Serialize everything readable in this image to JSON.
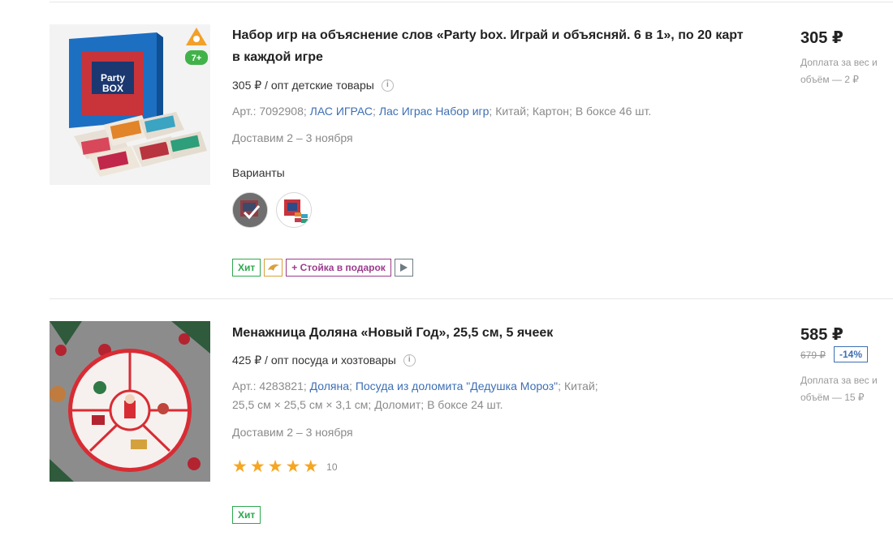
{
  "products": [
    {
      "title": "Набор игр на объяснение слов «Party box. Играй и объясняй. 6 в 1», по 20 карт в каждой игре",
      "opt": "305 ₽ / опт детские товары",
      "article": "Арт.: 7092908;",
      "brand": "ЛАС ИГРАС",
      "collection": "Лас Играс Набор игр",
      "country": "Китай;",
      "material": "Картон;",
      "box": "В боксе 46 шт.",
      "delivery": "Доставим 2 – 3 ноября",
      "variants_label": "Варианты",
      "badges": {
        "hit": "Хит",
        "gift": "+ Стойка в подарок"
      },
      "price": "305 ₽",
      "extra": "Доплата за вес и объём — 2 ₽",
      "image_age_label": "7+"
    },
    {
      "title": "Менажница Доляна «Новый Год», 25,5 см, 5 ячеек",
      "opt": "425 ₽ / опт посуда и хозтовары",
      "article": "Арт.: 4283821;",
      "brand": "Доляна",
      "collection": "Посуда из доломита \"Дедушка Мороз\"",
      "country": "Китай;",
      "dims": "25,5 см × 25,5 см × 3,1 см;",
      "material": "Доломит;",
      "box": "В боксе 24 шт.",
      "delivery": "Доставим 2 – 3 ноября",
      "rating": 5,
      "rating_count": "10",
      "badges": {
        "hit": "Хит"
      },
      "price": "585 ₽",
      "old_price": "679 ₽",
      "discount": "-14%",
      "extra": "Доплата за вес и объём — 15 ₽"
    }
  ],
  "colors": {
    "link": "#3d6fb4",
    "hit": "#2ea84f",
    "gift": "#9b3b8d",
    "star": "#f5a623"
  }
}
